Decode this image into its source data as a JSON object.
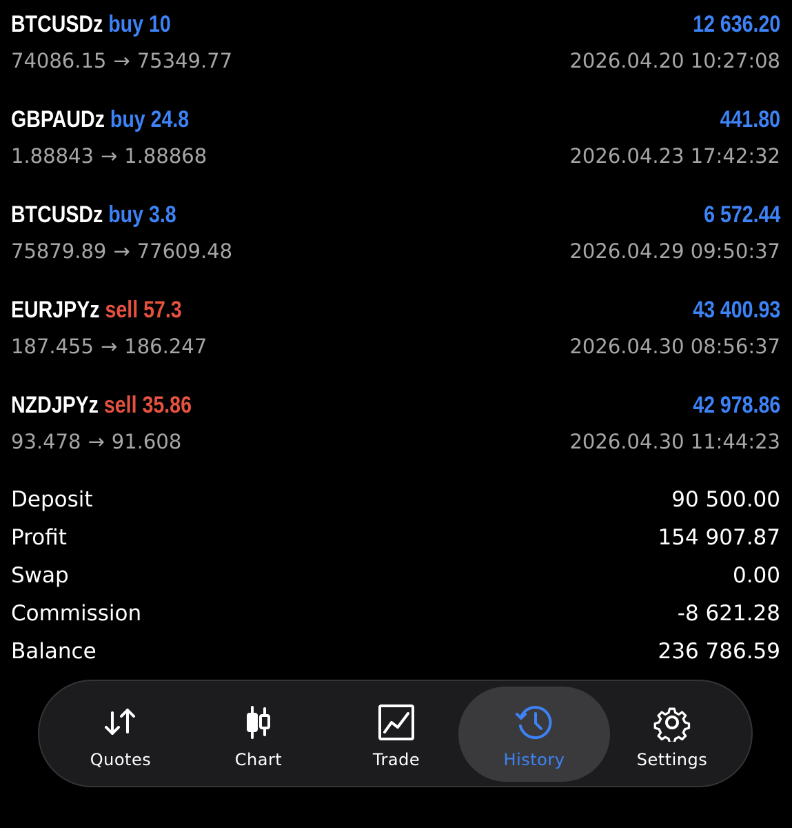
{
  "deals": [
    {
      "symbol": "BTCUSDz",
      "side": "buy",
      "volume": "10",
      "profit": "12 636.20",
      "open_price": "74086.15",
      "arrow": "→",
      "close_price": "75349.77",
      "time": "2026.04.20 10:27:08"
    },
    {
      "symbol": "GBPAUDz",
      "side": "buy",
      "volume": "24.8",
      "profit": "441.80",
      "open_price": "1.88843",
      "arrow": "→",
      "close_price": "1.88868",
      "time": "2026.04.23 17:42:32"
    },
    {
      "symbol": "BTCUSDz",
      "side": "buy",
      "volume": "3.8",
      "profit": "6 572.44",
      "open_price": "75879.89",
      "arrow": "→",
      "close_price": "77609.48",
      "time": "2026.04.29 09:50:37"
    },
    {
      "symbol": "EURJPYz",
      "side": "sell",
      "volume": "57.3",
      "profit": "43 400.93",
      "open_price": "187.455",
      "arrow": "→",
      "close_price": "186.247",
      "time": "2026.04.30 08:56:37"
    },
    {
      "symbol": "NZDJPYz",
      "side": "sell",
      "volume": "35.86",
      "profit": "42 978.86",
      "open_price": "93.478",
      "arrow": "→",
      "close_price": "91.608",
      "time": "2026.04.30 11:44:23"
    }
  ],
  "summary": {
    "deposit_label": "Deposit",
    "deposit_value": "90 500.00",
    "profit_label": "Profit",
    "profit_value": "154 907.87",
    "swap_label": "Swap",
    "swap_value": "0.00",
    "commission_label": "Commission",
    "commission_value": "-8 621.28",
    "balance_label": "Balance",
    "balance_value": "236 786.59"
  },
  "tabs": {
    "quotes": "Quotes",
    "chart": "Chart",
    "trade": "Trade",
    "history": "History",
    "settings": "Settings",
    "active": "history"
  },
  "colors": {
    "buy": "#3d82f6",
    "sell": "#e5523f",
    "profit": "#3d82f6",
    "secondary_text": "#a6a6a6",
    "active_tab": "#3d82f6"
  },
  "icons": {
    "quotes": "up-down-arrows-icon",
    "chart": "candlestick-icon",
    "trade": "line-chart-icon",
    "history": "history-clock-icon",
    "settings": "gear-icon"
  }
}
